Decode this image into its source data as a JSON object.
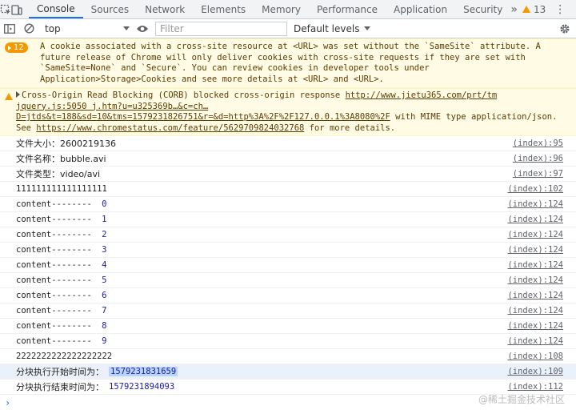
{
  "tabs": {
    "items": [
      {
        "label": "Console",
        "active": true
      },
      {
        "label": "Sources"
      },
      {
        "label": "Network"
      },
      {
        "label": "Elements"
      },
      {
        "label": "Memory"
      },
      {
        "label": "Performance"
      },
      {
        "label": "Application"
      },
      {
        "label": "Security"
      }
    ],
    "more": "»",
    "warning_count": "13",
    "kebab": "⋮",
    "close": "✕"
  },
  "toolbar": {
    "context": "top",
    "filter_placeholder": "Filter",
    "levels": "Default levels"
  },
  "warnings": [
    {
      "badge": "12",
      "text": "A cookie associated with a cross-site resource at <URL> was set without the `SameSite` attribute. A future release of Chrome will only deliver cookies with cross-site requests if they are set with `SameSite=None` and `Secure`. You can review cookies in developer tools under Application>Storage>Cookies and see more details at <URL> and <URL>."
    },
    {
      "prefix": "Cross-Origin Read Blocking (CORB) blocked cross-origin response ",
      "link1": "http://www.jietu365.com/prt/tm  jquery.js:5050 j.htm?u=u325369b…&c=ch…D=jtds&t=188&sd=10&tms=1579231826751&r=&d=http%3A%2F%2F127.0.0.1%3A8080%2F",
      "middle": " with MIME type application/json. See ",
      "link2": "https://www.chromestatus.com/feature/5629709824032768",
      "suffix": " for more details."
    }
  ],
  "logs": [
    {
      "text": "文件大小：2600219136",
      "src": "(index):95"
    },
    {
      "text": "文件名称：bubble.avi",
      "src": "(index):96"
    },
    {
      "text": "文件类型：video/avi",
      "src": "(index):97"
    },
    {
      "text": "111111111111111111",
      "src": "(index):102"
    },
    {
      "text": "content-------- ",
      "num": "0",
      "src": "(index):124"
    },
    {
      "text": "content-------- ",
      "num": "1",
      "src": "(index):124"
    },
    {
      "text": "content-------- ",
      "num": "2",
      "src": "(index):124"
    },
    {
      "text": "content-------- ",
      "num": "3",
      "src": "(index):124"
    },
    {
      "text": "content-------- ",
      "num": "4",
      "src": "(index):124"
    },
    {
      "text": "content-------- ",
      "num": "5",
      "src": "(index):124"
    },
    {
      "text": "content-------- ",
      "num": "6",
      "src": "(index):124"
    },
    {
      "text": "content-------- ",
      "num": "7",
      "src": "(index):124"
    },
    {
      "text": "content-------- ",
      "num": "8",
      "src": "(index):124"
    },
    {
      "text": "content-------- ",
      "num": "9",
      "src": "(index):124"
    },
    {
      "text": "2222222222222222222",
      "src": "(index):108"
    },
    {
      "text": "分块执行开始时间为：",
      "num": "1579231831659",
      "src": "(index):109",
      "selected": true
    },
    {
      "text": "分块执行结束时间为：",
      "num": "1579231894093",
      "src": "(index):112"
    }
  ],
  "prompt": "›",
  "watermark": "@稀土掘金技术社区",
  "colors": {
    "accent": "#1a73e8",
    "warning": "#f29900",
    "warn_bg": "#fffbe5",
    "number": "#1a1aa6"
  }
}
